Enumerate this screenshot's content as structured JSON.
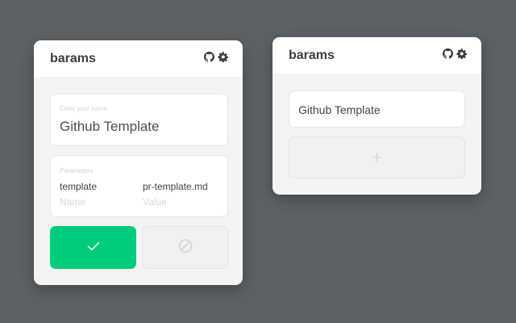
{
  "left_card": {
    "title": "barams",
    "icons": [
      "github-icon",
      "gear-icon"
    ],
    "name_field": {
      "label": "Enter your name",
      "value": "Github Template"
    },
    "parameters": {
      "label": "Parameters",
      "rows": [
        {
          "name": "template",
          "value": "pr-template.md"
        }
      ],
      "new_row": {
        "name_placeholder": "Name",
        "value_placeholder": "Value"
      }
    },
    "buttons": {
      "confirm_icon": "check-icon",
      "cancel_icon": "ban-icon"
    }
  },
  "right_card": {
    "title": "barams",
    "icons": [
      "github-icon",
      "gear-icon"
    ],
    "templates": [
      "Github Template"
    ],
    "add_button_label": "+"
  },
  "colors": {
    "background": "#5c6165",
    "card": "#f4f4f4",
    "accent_green": "#00cc79"
  }
}
